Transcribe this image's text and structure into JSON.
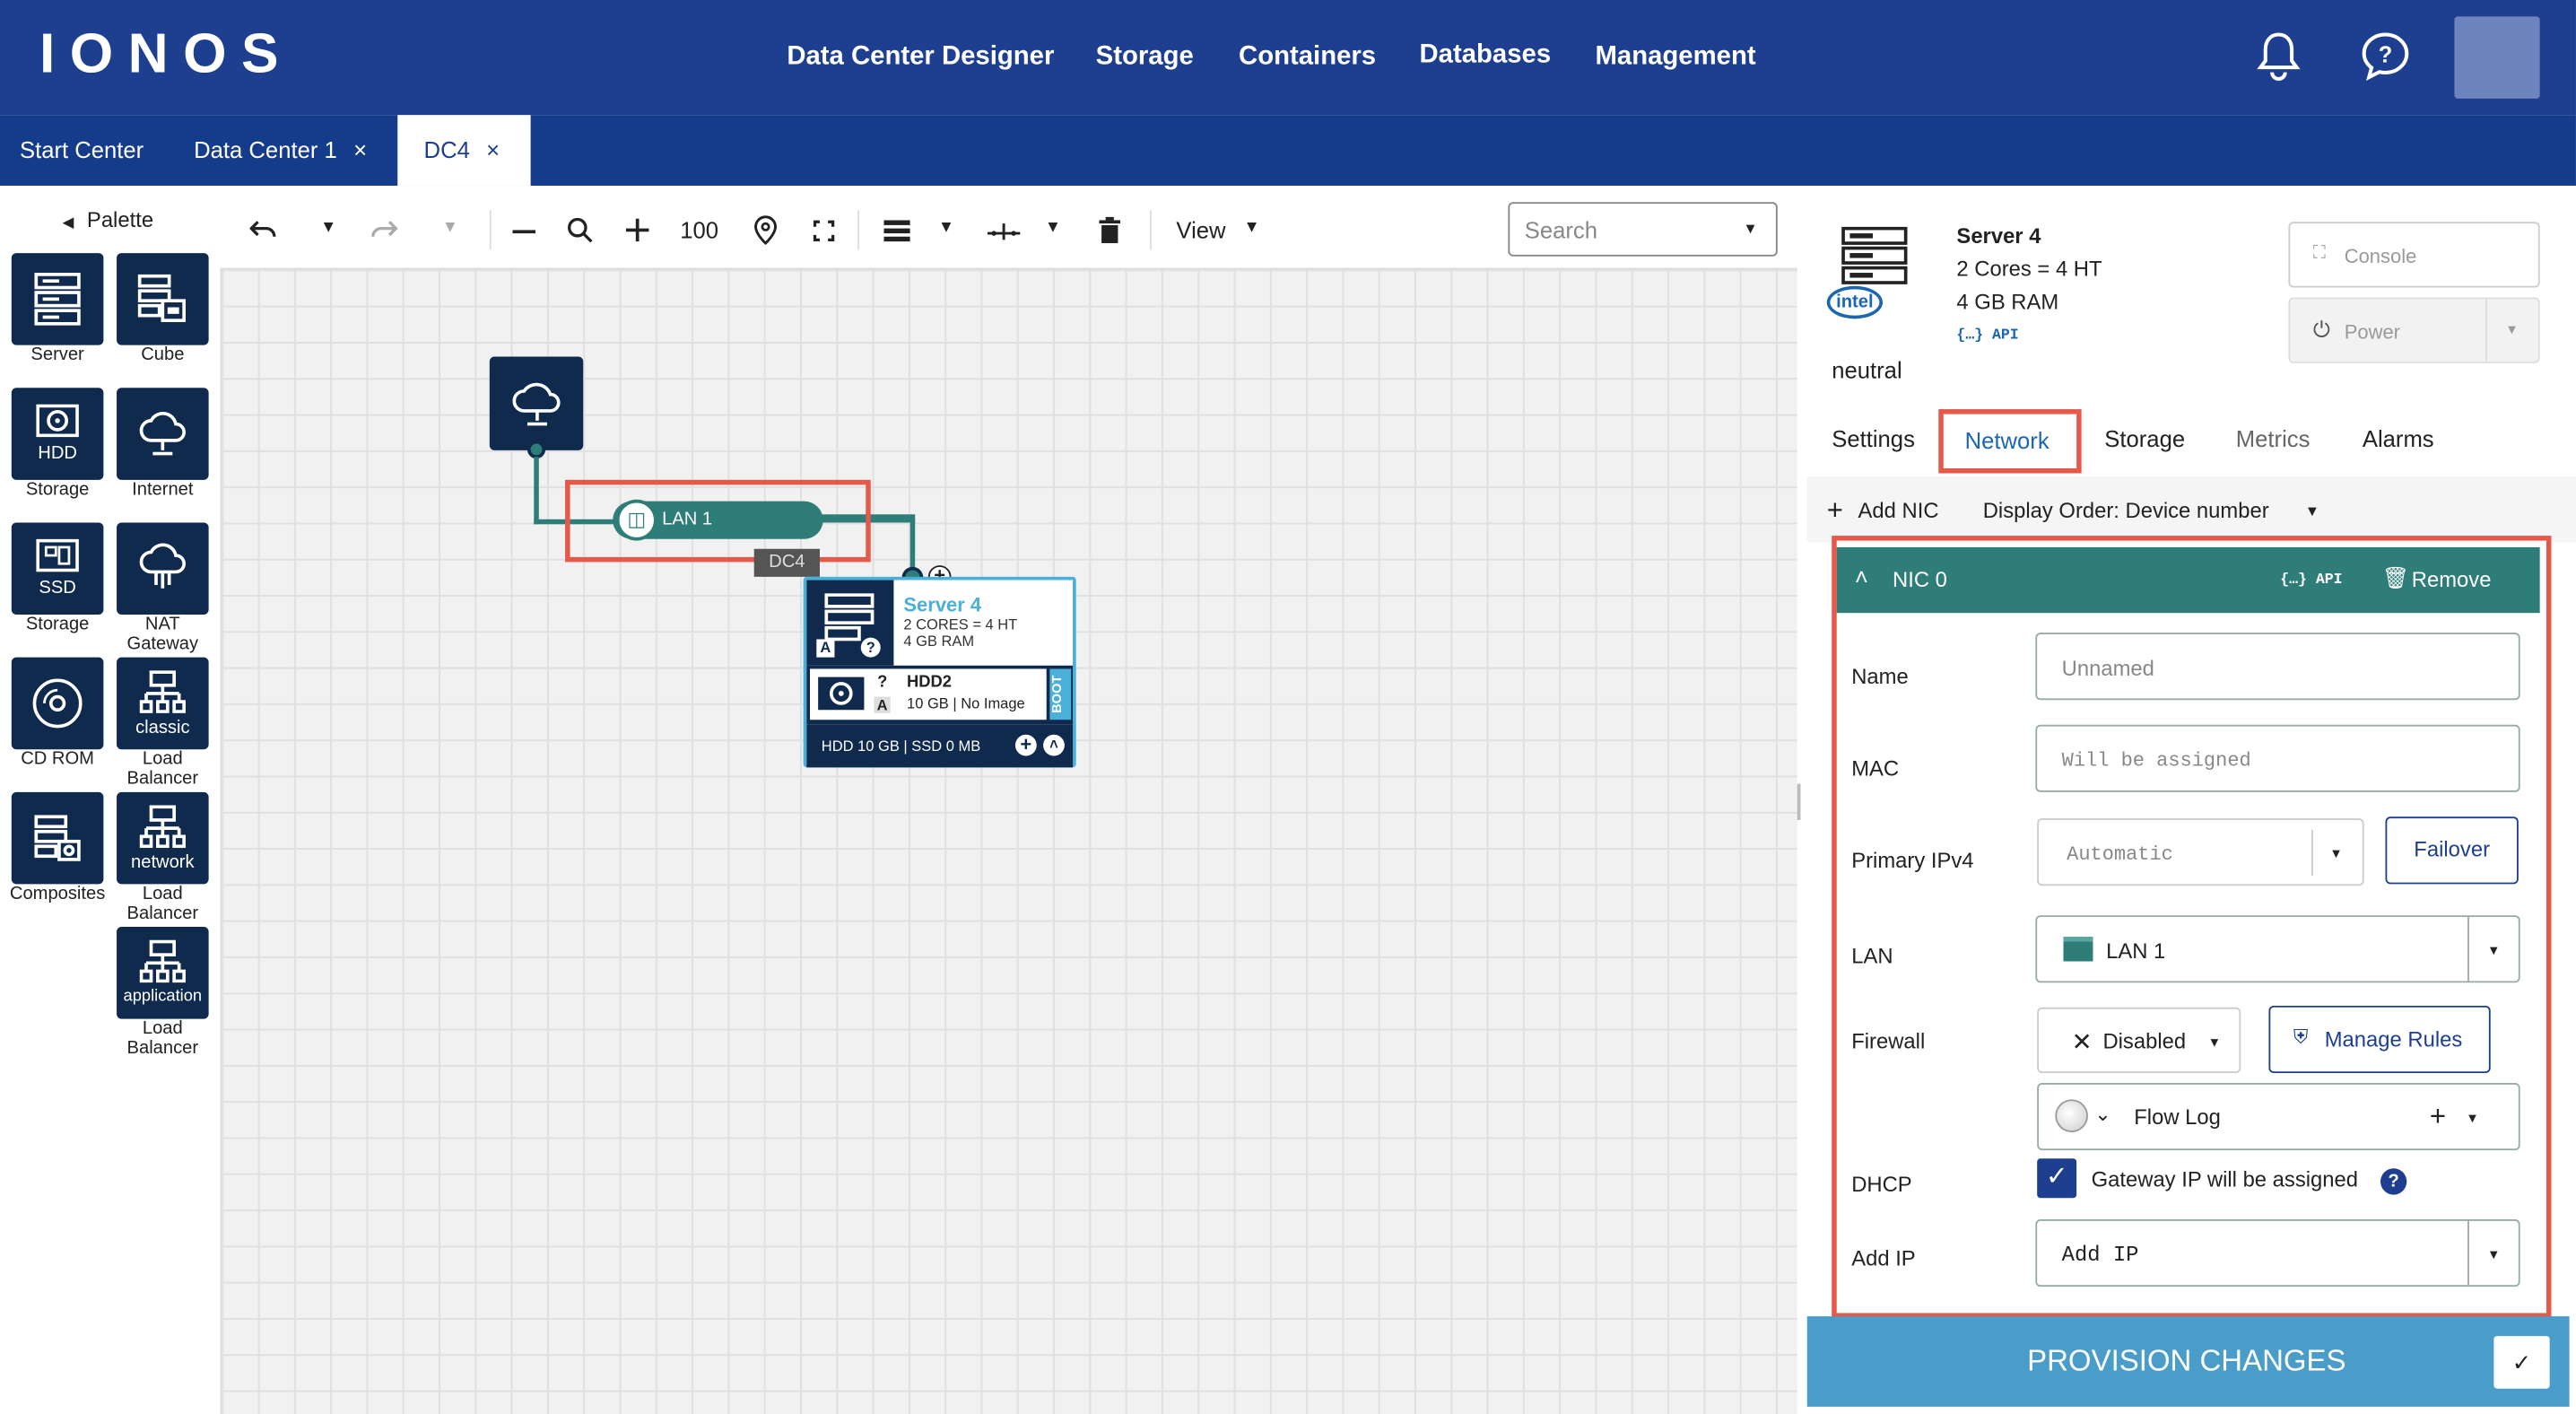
{
  "header": {
    "logo": "IONOS",
    "nav": [
      "Data Center Designer",
      "Storage",
      "Containers",
      "Databases",
      "Management"
    ]
  },
  "tabs": [
    {
      "label": "Start Center"
    },
    {
      "label": "Data Center 1",
      "close": "×"
    },
    {
      "label": "DC4",
      "close": "×"
    }
  ],
  "palette": {
    "title": "Palette",
    "items": [
      {
        "label": "Server",
        "icon": "server-icon"
      },
      {
        "label": "Cube",
        "icon": "cube-icon"
      },
      {
        "label": "HDD",
        "label2": "Storage",
        "icon": "hdd-icon"
      },
      {
        "label": "Internet",
        "icon": "cloud-icon"
      },
      {
        "label": "SSD",
        "label2": "Storage",
        "icon": "ssd-icon"
      },
      {
        "label": "NAT",
        "label2": "Gateway",
        "icon": "nat-gateway-icon"
      },
      {
        "label": "CD ROM",
        "icon": "cdrom-icon"
      },
      {
        "label": "classic",
        "label2": "Load",
        "label3": "Balancer",
        "icon": "load-balancer-icon"
      },
      {
        "label": "Composites",
        "icon": "composites-icon"
      },
      {
        "label": "network",
        "label2": "Load",
        "label3": "Balancer",
        "icon": "load-balancer-icon"
      },
      {
        "label": "application",
        "label2": "Load",
        "label3": "Balancer",
        "icon": "load-balancer-icon"
      }
    ]
  },
  "toolbar": {
    "zoom": "100",
    "view": "View",
    "search_placeholder": "Search"
  },
  "canvas": {
    "lan_label": "LAN 1",
    "dc_label": "DC4",
    "server": {
      "name": "Server 4",
      "spec1": "2 CORES = 4 HT",
      "spec2": "4 GB RAM",
      "badge_a": "A",
      "badge_q": "?"
    },
    "hdd": {
      "name": "HDD2",
      "spec": "10 GB | No Image",
      "badge_q": "?",
      "badge_a": "A",
      "boot": "BOOT"
    },
    "footer": "HDD 10 GB | SSD 0 MB"
  },
  "panel": {
    "server_name": "Server 4",
    "spec1": "2 Cores = 4 HT",
    "spec2": "4 GB RAM",
    "api": "{…} API",
    "intel": "intel",
    "vendor": "neutral",
    "console": "Console",
    "power": "Power",
    "tabs": [
      "Settings",
      "Network",
      "Storage",
      "Metrics",
      "Alarms"
    ],
    "add_nic": "Add NIC",
    "display_order": "Display Order: Device number",
    "nic": {
      "title": "NIC 0",
      "api": "{…} API",
      "remove": "Remove",
      "name_label": "Name",
      "name_placeholder": "Unnamed",
      "mac_label": "MAC",
      "mac_placeholder": "Will be assigned",
      "ipv4_label": "Primary IPv4",
      "ipv4_value": "Automatic",
      "failover": "Failover",
      "lan_label": "LAN",
      "lan_value": "LAN 1",
      "firewall_label": "Firewall",
      "firewall_value": "Disabled",
      "manage_rules": "Manage Rules",
      "flowlog": "Flow Log",
      "dhcp_label": "DHCP",
      "dhcp_text": "Gateway IP will be assigned",
      "addip_label": "Add IP",
      "addip_value": "Add IP"
    },
    "provision": "PROVISION CHANGES"
  },
  "colors": {
    "header": "#1e3f8f",
    "tabbar": "#153c8a",
    "teal": "#2e7d78",
    "highlight": "#e5584a",
    "provision": "#4a9cc9"
  }
}
